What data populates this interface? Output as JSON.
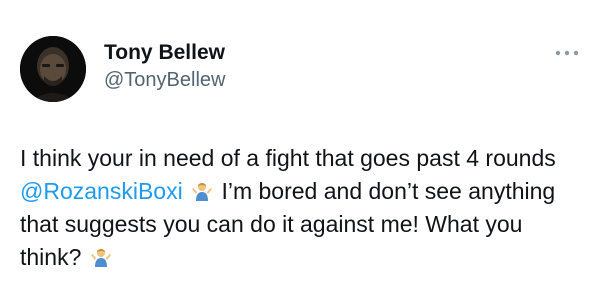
{
  "tweet": {
    "author": {
      "display_name": "Tony Bellew",
      "handle": "@TonyBellew",
      "avatar_icon": "profile-photo"
    },
    "more_icon": "ellipsis-icon",
    "text": {
      "part1": "I think your in need of a fight that goes past 4 rounds ",
      "mention": "@RozanskiBoxi",
      "part2": " I’m bored and don’t see anything that suggests you can do it against me! What you think? ",
      "emoji_name": "person-shrugging-emoji"
    },
    "colors": {
      "text": "#0f1419",
      "secondary": "#536471",
      "link": "#1d9bf0"
    }
  }
}
